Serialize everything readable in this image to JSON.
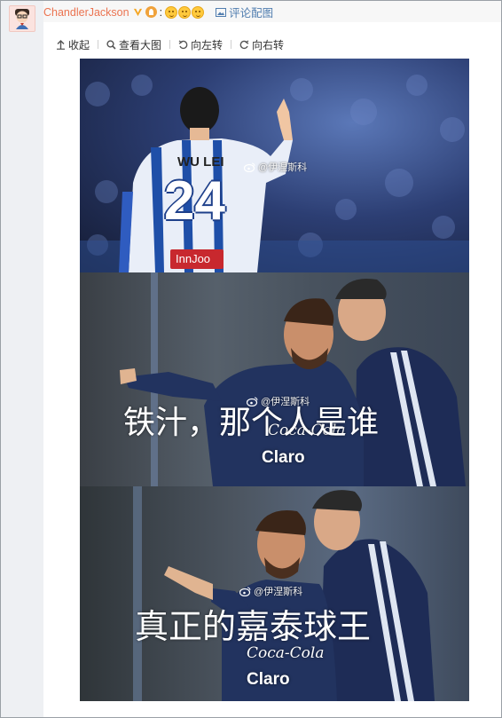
{
  "comment": {
    "username": "ChandlerJackson",
    "colon": ":",
    "image_comment_label": "评论配图"
  },
  "toolbar": {
    "collapse": "收起",
    "view_large": "查看大图",
    "rotate_left": "向左转",
    "rotate_right": "向右转"
  },
  "image": {
    "panel1": {
      "jersey_name": "WU LEI",
      "jersey_number": "24",
      "sponsor": "InnJoo",
      "watermark": "@伊涅斯科"
    },
    "panel2": {
      "caption": "铁汁，那个人是谁",
      "watermark": "@伊涅斯科",
      "sponsor1": "Coca-Cola",
      "sponsor2": "Claro"
    },
    "panel3": {
      "caption": "真正的嘉泰球王",
      "watermark": "@伊涅斯科",
      "sponsor1": "Coca-Cola",
      "sponsor2": "Claro"
    }
  },
  "colors": {
    "username": "#eb7350",
    "link": "#507daf"
  }
}
